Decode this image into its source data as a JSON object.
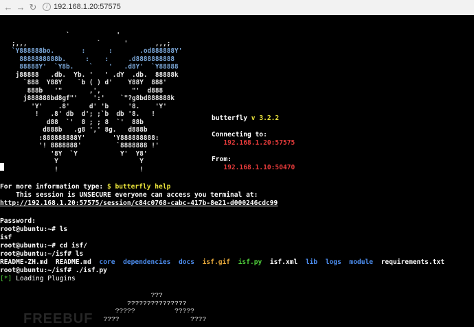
{
  "browser": {
    "url": "192.168.1.20:57575",
    "back_glyph": "←",
    "forward_glyph": "→",
    "reload_glyph": "↻"
  },
  "ascii_art": {
    "lines": [
      "              `            '",
      ";,,,                  `      '       ,,,;",
      "`Y888888bo.       :      :       .od888888Y'",
      "  8888888888b.     :    :     .d8888888888",
      "  88888Y'  `Y8b.    `    '   .d8Y'  `Y88888",
      " j88888   .db.  Yb. '   ' .dY  .db.  88888k",
      "   `888  Y88Y    `b ( ) d'    Y88Y  888'",
      "    888b   '\"       ,',        \"'  d888",
      "   j888888bd8gf\"'    ':'    `\"?g8bd888888k",
      "     'Y'    .8'     d' 'b     '8.    'Y'",
      "      !   .8' db  d'; ;`b  db '8.   !",
      "         d88  `'  8 ; ; 8  `'  88b",
      "        d888b   .g8 ',' 8g.   d888b",
      "       :888888888Y'       'Y888888888:",
      "       '! 8888888'         `8888888 !'",
      "          '8Y  `Y           Y'  Y8'",
      "           Y                     Y",
      "           !                     !"
    ]
  },
  "banner": {
    "name": "butterfly",
    "version": "v 3.2.2",
    "connecting_label": "Connecting to:",
    "connecting_addr": "192.168.1.20:57575",
    "from_label": "From:",
    "from_addr": "192.168.1.10:50470"
  },
  "terminal": {
    "help_prefix": "For more information type: ",
    "help_cmd": "$ butterfly help",
    "warning": "    This session is UNSECURE everyone can access you terminal at:",
    "session_url": "http://192.168.1.20:57575/session/c84c0768-cabc-417b-8e21-d000246cdc99",
    "password_prompt": "Password:",
    "prompt1": "root@ubuntu:~# ls",
    "ls1": "isf",
    "prompt2": "root@ubuntu:~# cd isf/",
    "prompt3": "root@ubuntu:~/isf# ls",
    "files": [
      {
        "name": "README-ZH.md",
        "color": "#ffffff"
      },
      {
        "name": "README.md",
        "color": "#ffffff"
      },
      {
        "name": "core",
        "color": "#4d8ef0"
      },
      {
        "name": "dependencies",
        "color": "#4d8ef0"
      },
      {
        "name": "docs",
        "color": "#4d8ef0"
      },
      {
        "name": "isf.gif",
        "color": "#e8a93a"
      },
      {
        "name": "isf.py",
        "color": "#4fcf3b"
      },
      {
        "name": "isf.xml",
        "color": "#ffffff"
      },
      {
        "name": "lib",
        "color": "#4d8ef0"
      },
      {
        "name": "logs",
        "color": "#4d8ef0"
      },
      {
        "name": "module",
        "color": "#4d8ef0"
      },
      {
        "name": "requirements.txt",
        "color": "#ffffff"
      }
    ],
    "prompt4": "root@ubuntu:~/isf# ./isf.py",
    "loading_tag": "[*]",
    "loading_text": " Loading Plugins",
    "q_art": [
      "              ???",
      "        ???????????????",
      "     ?????          ?????",
      "  ????                  ????"
    ]
  },
  "watermark": "FREEBUF"
}
